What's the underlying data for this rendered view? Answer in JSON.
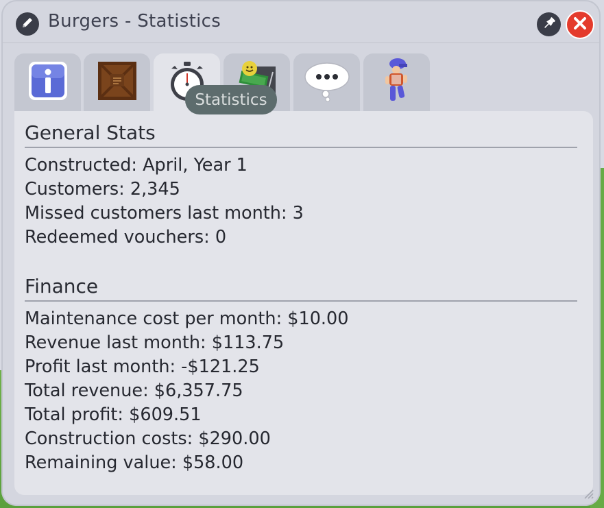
{
  "window": {
    "title": "Burgers - Statistics"
  },
  "tabs": [
    {
      "icon": "info-icon"
    },
    {
      "icon": "crate-icon"
    },
    {
      "icon": "stopwatch-icon"
    },
    {
      "icon": "money-icon"
    },
    {
      "icon": "speech-bubble-icon"
    },
    {
      "icon": "staff-icon"
    }
  ],
  "tooltip": "Statistics",
  "general": {
    "title": "General Stats",
    "lines": [
      "Constructed: April, Year 1",
      "Customers: 2,345",
      "Missed customers last month: 3",
      "Redeemed vouchers: 0"
    ]
  },
  "finance": {
    "title": "Finance",
    "lines": [
      "Maintenance cost per month: $10.00",
      "Revenue last month: $113.75",
      "Profit last month: -$121.25",
      "Total revenue: $6,357.75",
      "Total profit: $609.51",
      "Construction costs: $290.00",
      "Remaining value: $58.00"
    ]
  },
  "colors": {
    "window": "#d4d6df",
    "panel": "#e3e4ea",
    "close": "#e43b2c",
    "tooltip": "#5d6c6d"
  }
}
